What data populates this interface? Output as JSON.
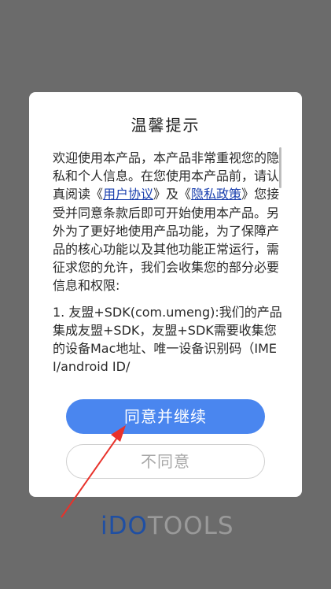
{
  "dialog": {
    "title": "温馨提示",
    "intro_part1": "欢迎使用本产品，本产品非常重视您的隐私和个人信息。在您使用本产品前，请认真阅读《",
    "user_agreement_link": "用户协议",
    "intro_part2": "》及《",
    "privacy_link": "隐私政策",
    "intro_part3": "》您接受并同意条款后即可开始使用本产品。另外为了更好地使用产品功能，为了保障产品的核心功能以及其他功能正常运行，需征求您的允许，我们会收集您的部分必要信息和权限:",
    "item1": "1. 友盟+SDK(com.umeng):我们的产品集成友盟+SDK，友盟+SDK需要收集您的设备Mac地址、唯一设备识别码（IMEI/android ID/"
  },
  "buttons": {
    "agree": "同意并继续",
    "disagree": "不同意"
  },
  "watermark": {
    "part1": "iDO",
    "part2": "TOOLS"
  },
  "colors": {
    "accent": "#4a86ef",
    "overlay": "#6b6b6b",
    "arrow": "#e8322b"
  }
}
